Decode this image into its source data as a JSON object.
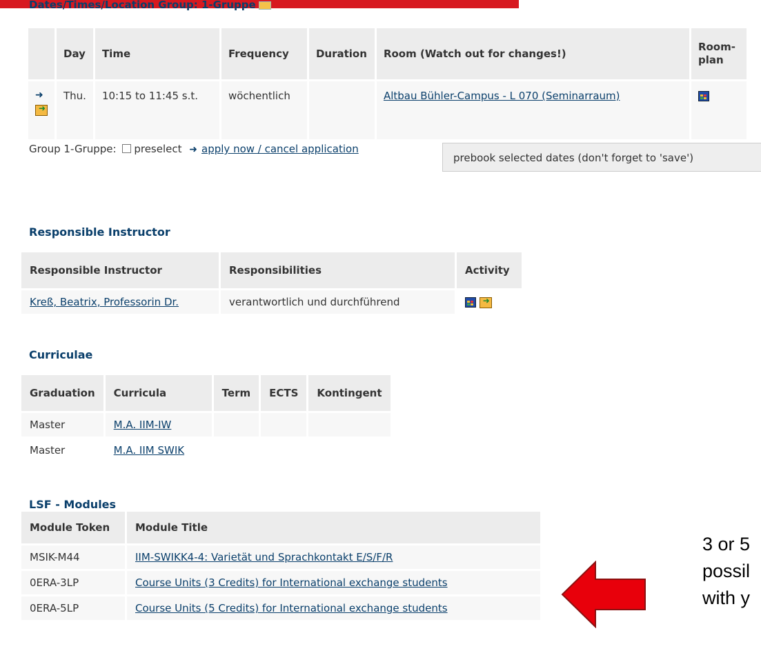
{
  "heading_cut": "Dates/Times/Location Group: 1-Gruppe",
  "dates_table": {
    "headers": [
      "",
      "Day",
      "Time",
      "Frequency",
      "Duration",
      "Room (Watch out for changes!)",
      "Room-plan"
    ],
    "row": {
      "day": "Thu.",
      "time": "10:15 to 11:45 s.t.",
      "frequency": "wöchentlich",
      "duration": "",
      "room": "Altbau Bühler-Campus - L 070 (Seminarraum)"
    }
  },
  "group": {
    "label": "Group 1-Gruppe:",
    "preselect": "preselect",
    "apply_link": "apply now / cancel application",
    "prebook_button": "prebook selected dates (don't forget to 'save')"
  },
  "instructor_section": {
    "title": "Responsible Instructor",
    "headers": [
      "Responsible Instructor",
      "Responsibilities",
      "Activity"
    ],
    "row": {
      "name": "Kreß, Beatrix, Professorin Dr.",
      "responsibility": "verantwortlich und durchführend"
    }
  },
  "curricula_section": {
    "title": "Curriculae",
    "headers": [
      "Graduation",
      "Curricula",
      "Term",
      "ECTS",
      "Kontingent"
    ],
    "rows": [
      {
        "graduation": "Master",
        "curricula": "M.A. IIM-IW"
      },
      {
        "graduation": "Master",
        "curricula": "M.A. IIM SWIK"
      }
    ]
  },
  "modules_section": {
    "title": "LSF - Modules",
    "headers": [
      "Module Token",
      "Module Title"
    ],
    "rows": [
      {
        "token": "MSIK-M44",
        "title": "IIM-SWIKK4-4: Varietät und Sprachkontakt E/S/F/R"
      },
      {
        "token": "0ERA-3LP",
        "title": "Course Units (3 Credits) for International exchange students"
      },
      {
        "token": "0ERA-5LP",
        "title": "Course Units (5 Credits) for International exchange students"
      }
    ]
  },
  "annotation": {
    "lines": [
      "3 or 5",
      "possil",
      "with y"
    ],
    "arrow_color": "#e8000b"
  }
}
